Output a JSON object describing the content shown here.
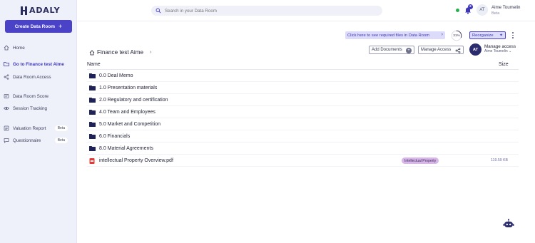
{
  "brand": {
    "logo_text": "ADALY"
  },
  "sidebar": {
    "create_button": "Create Data Room",
    "items": [
      {
        "label": "Home",
        "icon": "home-icon"
      },
      {
        "label": "Go to Finance test Aime",
        "icon": "folder-icon"
      },
      {
        "label": "Data Room Access",
        "icon": "share-icon"
      },
      {
        "label": "Data Room Score",
        "icon": "score-icon"
      },
      {
        "label": "Session Tracking",
        "icon": "eye-icon"
      },
      {
        "label": "Valuation Report",
        "icon": "report-icon",
        "badge": "Beta"
      },
      {
        "label": "Questionnaire",
        "icon": "chat-icon",
        "badge": "Beta"
      }
    ]
  },
  "topbar": {
    "search_placeholder": "Search in your Data Room",
    "notification_count": "2",
    "avatar_initials": "AT",
    "user_name": "Aime Toumelin",
    "user_role": "Beta",
    "status_color": "#22b14c"
  },
  "toolbar": {
    "hint": "Click here to see required files in Data Room",
    "progress": "31%",
    "progress_value": 0.31,
    "reorganize": "Reorganize",
    "add_documents": "Add Documents",
    "manage_access": "Manage Access",
    "manage_access_title": "Manage access",
    "manage_access_user": "Aime Toumelin",
    "owner_initials": "AT"
  },
  "breadcrumb": {
    "title": "Finance test Aime"
  },
  "table": {
    "columns": {
      "name": "Name",
      "size": "Size"
    },
    "folders": [
      "0.0 Deal Memo",
      "1.0 Presentation materials",
      "2.0 Regulatory and certification",
      "4.0 Team and Employees",
      "5.0 Market and Competition",
      "6.0 Financials",
      "8.0 Material Agreements"
    ],
    "files": [
      {
        "name": "intellectual Property Overview.pdf",
        "tag": "Intellectual Property",
        "size": "119.59 KB"
      }
    ]
  },
  "colors": {
    "accent": "#4a43c8",
    "sidebar_bg": "#eef0fa",
    "folder": "#1e2257",
    "tag_bg": "#d8b6ea"
  }
}
